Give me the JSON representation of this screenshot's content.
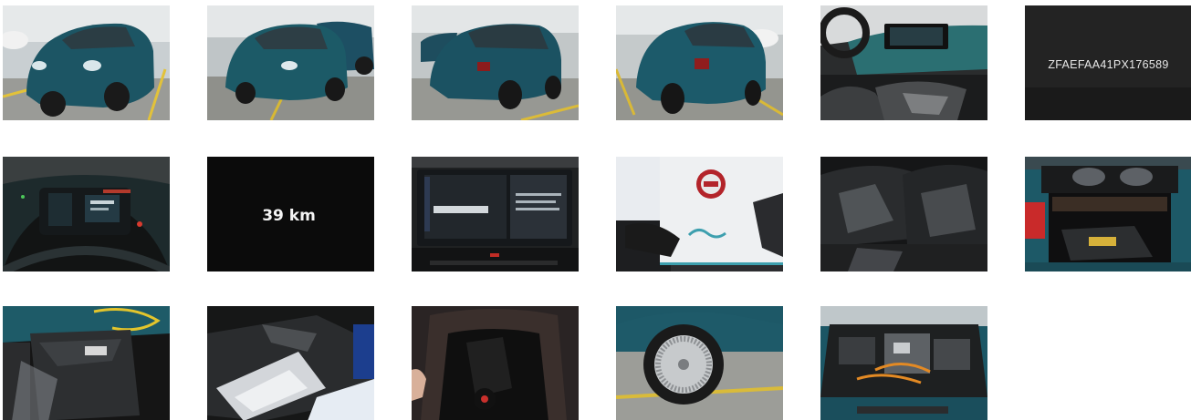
{
  "gallery": {
    "photos": [
      {
        "subject": "front-left-exterior",
        "color": "#1f5a66"
      },
      {
        "subject": "front-exterior",
        "color": "#1f5a66"
      },
      {
        "subject": "rear-left-exterior",
        "color": "#1f5a66"
      },
      {
        "subject": "rear-exterior",
        "color": "#1f5a66"
      },
      {
        "subject": "dashboard-interior",
        "color": "#2a6f73"
      },
      {
        "subject": "vin-plate",
        "text": "ZFAEFAA41PX176589"
      },
      {
        "subject": "instrument-cluster"
      },
      {
        "subject": "odometer-display",
        "text": "39 km"
      },
      {
        "subject": "infotainment-screen"
      },
      {
        "subject": "owner-manual"
      },
      {
        "subject": "rear-seats-wrapped"
      },
      {
        "subject": "trunk-open"
      },
      {
        "subject": "charging-cable-bag"
      },
      {
        "subject": "wrapped-parts"
      },
      {
        "subject": "trunk-storage-bag"
      },
      {
        "subject": "wheel-rim"
      },
      {
        "subject": "engine-bay"
      }
    ]
  }
}
